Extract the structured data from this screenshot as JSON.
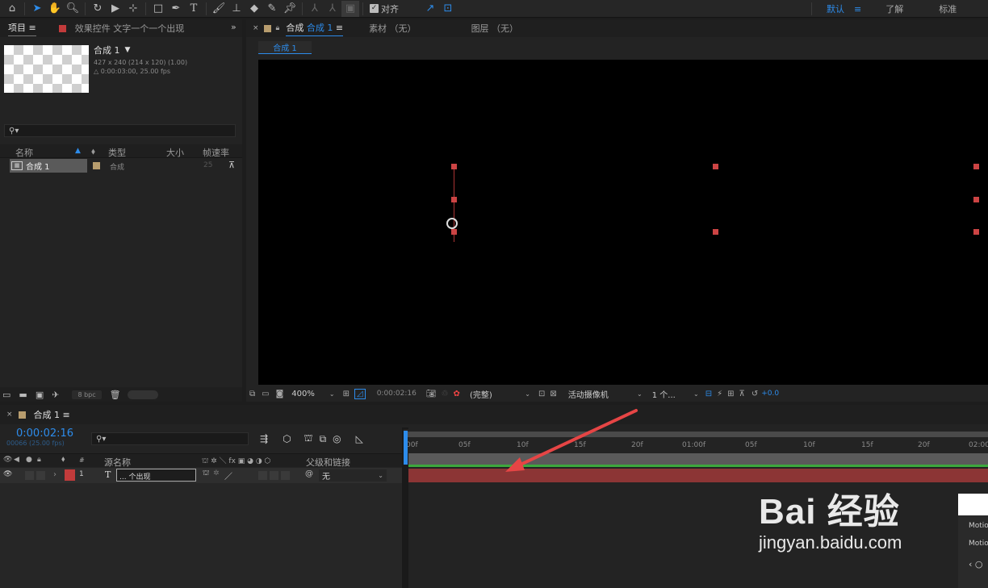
{
  "toolbar": {
    "tools": [
      "home-icon",
      "arrow-icon",
      "hand-icon",
      "zoom-icon",
      "rotate-icon",
      "camera-icon",
      "pan-behind-icon",
      "rectangle-icon",
      "pen-icon",
      "text-icon",
      "brush-icon",
      "clone-stamp-icon",
      "eraser-icon",
      "roto-brush-icon",
      "puppet-pin-icon"
    ],
    "align_label": "对齐",
    "workspaces": [
      "默认",
      "了解",
      "标准"
    ],
    "active_workspace": "默认"
  },
  "project": {
    "tab_label": "项目",
    "effects_tab_label": "效果控件 文字一个一个出现",
    "comp_name": "合成 1",
    "comp_meta1": "427 x 240  (214 x 120) (1.00)",
    "comp_meta2": "△ 0:00:03:00, 25.00 fps",
    "columns": [
      "名称",
      "类型",
      "大小",
      "帧速率"
    ],
    "items": [
      {
        "name": "合成 1",
        "type": "合成",
        "size": "",
        "fps": "25"
      }
    ],
    "bpc": "8 bpc"
  },
  "viewer": {
    "tab_prefix": "合成",
    "tab_comp": "合成 1",
    "footage_tab": "素材 （无）",
    "layer_tab": "图层 （无）",
    "comp_chip": "合成 1",
    "zoom": "400%",
    "timecode": "0:00:02:16",
    "resolution": "(完整)",
    "camera": "活动摄像机",
    "views": "1 个...",
    "exposure": "+0.0"
  },
  "timeline": {
    "tab_label": "合成 1",
    "timecode": "0:00:02:16",
    "frame_info": "00066 (25.00 fps)",
    "col_source": "源名称",
    "col_parent": "父级和链接",
    "layer": {
      "index": "1",
      "type": "T",
      "name": "... 个出现",
      "parent": "无"
    },
    "ruler_ticks": [
      ":00f",
      "05f",
      "10f",
      "15f",
      "20f",
      "01:00f",
      "05f",
      "10f",
      "15f",
      "20f",
      "02:00"
    ]
  },
  "watermark": {
    "brand": "Bai 经验",
    "url": "jingyan.baidu.com",
    "motion1": "Motio",
    "motion2": "Motio"
  },
  "colors": {
    "accent": "#2d8ceb",
    "label_red": "#c23b3b",
    "layer_bar": "#8c3535",
    "arrow": "#e64545"
  }
}
